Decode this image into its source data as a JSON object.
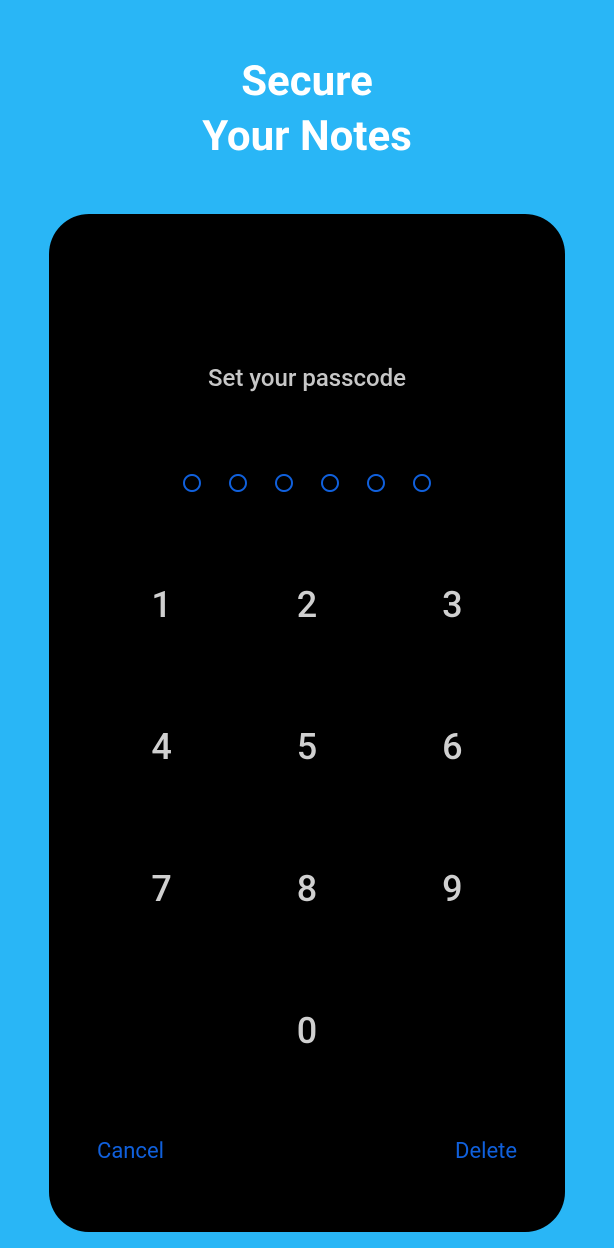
{
  "header": {
    "title_line1": "Secure",
    "title_line2": "Your Notes"
  },
  "passcode": {
    "prompt": "Set your passcode",
    "dots_count": 6,
    "keys": [
      "1",
      "2",
      "3",
      "4",
      "5",
      "6",
      "7",
      "8",
      "9",
      "0"
    ]
  },
  "actions": {
    "cancel_label": "Cancel",
    "delete_label": "Delete"
  }
}
